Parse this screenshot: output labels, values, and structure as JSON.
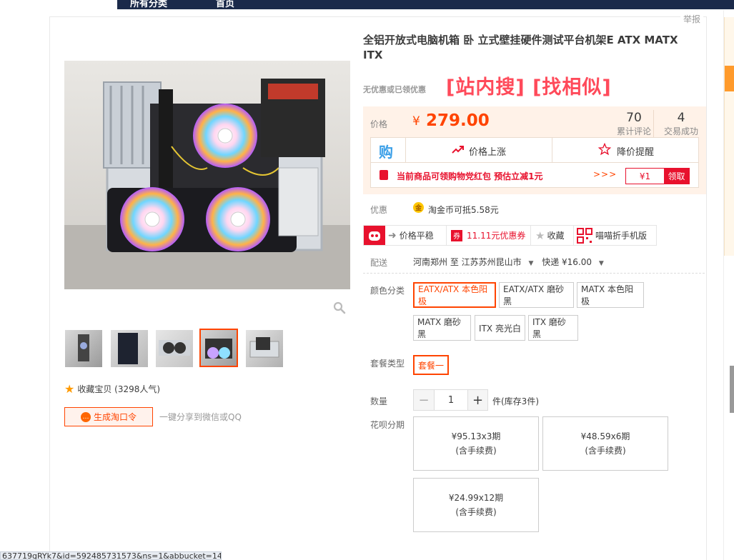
{
  "topbar": {
    "item1": "所有分类",
    "item2": "首页"
  },
  "report_label": "举报",
  "product": {
    "title": "全铝开放式电脑机箱 卧 立式壁挂硬件测试平台机架E ATX MATX ITX",
    "no_discount": "无优惠或已领优惠",
    "search_links": "[站内搜] [找相似]"
  },
  "price": {
    "label": "价格",
    "symbol": "¥",
    "value": "279.00",
    "reviews_count": "70",
    "reviews_label": "累计评论",
    "trades_count": "4",
    "trades_label": "交易成功"
  },
  "price_tools": {
    "gou_icon_text": "购",
    "up_label": "价格上涨",
    "drop_label": "降价提醒"
  },
  "red_packet": {
    "text": "当前商品可领购物党红包 预估立减1元",
    "arrows": ">>>",
    "amount": "¥1",
    "get_label": "领取"
  },
  "promo": {
    "label": "优惠",
    "coin_text": "淘金币可抵5.58元"
  },
  "tools_strip": {
    "price_flat": "价格平稳",
    "coupon_tag": "券",
    "coupon_text": "11.11元优惠券",
    "favorite": "收藏",
    "mobile": "喵喵折手机版"
  },
  "delivery": {
    "label": "配送",
    "from_to": "河南郑州 至  江苏苏州昆山市",
    "express": "快递 ¥16.00"
  },
  "color": {
    "label": "颜色分类",
    "options": [
      "EATX/ATX 本色阳极",
      "EATX/ATX 磨砂黑",
      "MATX 本色阳极",
      "MATX 磨砂黑",
      "ITX 亮光白",
      "ITX 磨砂黑"
    ],
    "selected": "EATX/ATX 本色阳极"
  },
  "package": {
    "label": "套餐类型",
    "options": [
      "套餐一"
    ],
    "selected": "套餐一"
  },
  "quantity": {
    "label": "数量",
    "value": "1",
    "minus": "−",
    "plus": "+",
    "unit": "件(库存3件)"
  },
  "installment": {
    "label": "花呗分期",
    "options": [
      {
        "price": "¥95.13x3期",
        "fee": "(含手续费)"
      },
      {
        "price": "¥48.59x6期",
        "fee": "(含手续费)"
      },
      {
        "price": "¥24.99x12期",
        "fee": "(含手续费)"
      }
    ]
  },
  "left": {
    "collect": "收藏宝贝 (3298人气)",
    "gen_button": "生成淘口令",
    "share_text": "一键分享到微信或QQ"
  },
  "status_url": "637719gRYk7&id=592485731573&ns=1&abbucket=14#",
  "colors": {
    "accent": "#ff4400",
    "red": "#e8112d",
    "price_bg": "#fff2e8"
  }
}
